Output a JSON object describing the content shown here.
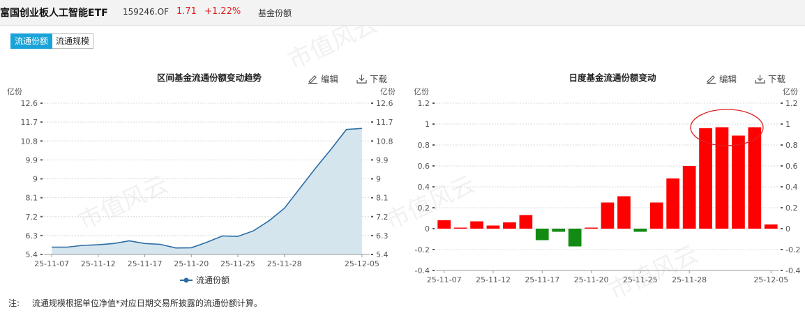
{
  "header": {
    "fund_name": "富国创业板人工智能ETF",
    "code": "159246.OF",
    "price": "1.71",
    "change_pct": "+1.22%",
    "metric": "基金份额"
  },
  "tabs": [
    {
      "label": "流通份额",
      "active": true
    },
    {
      "label": "流通规模",
      "active": false
    }
  ],
  "toolbar": {
    "edit_label": "编辑",
    "download_label": "下载"
  },
  "left_chart": {
    "title": "区间基金流通份额变动趋势",
    "unit": "亿份",
    "legend": "流通份额"
  },
  "right_chart": {
    "title": "日度基金流通份额变动",
    "unit": "亿份"
  },
  "note": {
    "label": "注:",
    "text": "流通规模根据单位净值*对应日期交易所披露的流通份额计算。"
  },
  "chart_data": [
    {
      "type": "area",
      "title": "区间基金流通份额变动趋势",
      "ylabel": "亿份",
      "ylim": [
        5.4,
        12.6
      ],
      "yticks": [
        5.4,
        6.3,
        7.2,
        8.1,
        9,
        9.9,
        10.8,
        11.7,
        12.6
      ],
      "ytick_labels": [
        "5.4",
        "6.3",
        "7.2",
        "8.1",
        "9",
        "9.9",
        "10.8",
        "11.7",
        "12.6"
      ],
      "x_tick_labels": [
        "25-11-07",
        "25-11-12",
        "25-11-17",
        "25-11-20",
        "25-11-25",
        "25-11-28",
        "25-12-05"
      ],
      "x_tick_index": [
        0,
        3,
        6,
        9,
        12,
        15,
        20
      ],
      "series": [
        {
          "name": "流通份额",
          "values": [
            5.75,
            5.75,
            5.83,
            5.86,
            5.92,
            6.05,
            5.92,
            5.88,
            5.71,
            5.72,
            5.98,
            6.28,
            6.26,
            6.52,
            7.0,
            7.6,
            8.55,
            9.5,
            10.4,
            11.35,
            11.4
          ]
        }
      ],
      "color": "#2b6ca3",
      "fill": "#d4e5ee",
      "grid": true
    },
    {
      "type": "bar",
      "title": "日度基金流通份额变动",
      "ylabel": "亿份",
      "ylim": [
        -0.4,
        1.2
      ],
      "yticks": [
        -0.4,
        -0.2,
        0,
        0.2,
        0.4,
        0.6,
        0.8,
        1,
        1.2
      ],
      "ytick_labels": [
        "-0.4",
        "-0.2",
        "0",
        "0.2",
        "0.4",
        "0.6",
        "0.8",
        "1",
        "1.2"
      ],
      "x_tick_labels": [
        "25-11-07",
        "25-11-12",
        "25-11-17",
        "25-11-20",
        "25-11-25",
        "25-11-28",
        "25-12-05"
      ],
      "x_tick_index": [
        0,
        3,
        6,
        9,
        12,
        15,
        20
      ],
      "values": [
        0.08,
        0.01,
        0.07,
        0.03,
        0.06,
        0.13,
        -0.11,
        -0.03,
        -0.17,
        0.01,
        0.25,
        0.31,
        -0.03,
        0.25,
        0.48,
        0.6,
        0.96,
        0.97,
        0.89,
        0.97,
        0.04
      ],
      "positive_color": "#ff0000",
      "negative_color": "#138a13",
      "annotation": "ellipse",
      "grid": true
    }
  ]
}
